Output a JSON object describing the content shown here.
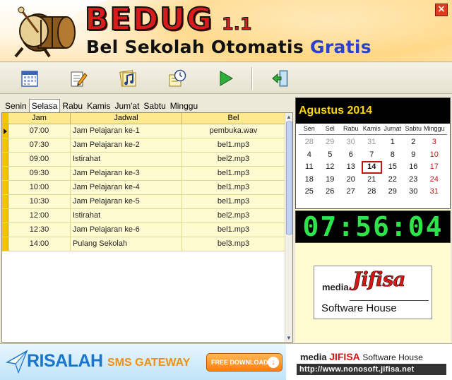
{
  "header": {
    "title": "BEDUG",
    "version": "1.1",
    "subtitle_main": "Bel Sekolah Otomatis",
    "subtitle_accent": "Gratis",
    "close_label": "×"
  },
  "toolbar": {
    "buttons": [
      "calendar-icon",
      "edit-icon",
      "music-icon",
      "clock-icon",
      "play-icon",
      "exit-icon"
    ]
  },
  "tabs": [
    "Senin",
    "Selasa",
    "Rabu",
    "Kamis",
    "Jum'at",
    "Sabtu",
    "Minggu"
  ],
  "active_tab": "Selasa",
  "table": {
    "headers": [
      "Jam",
      "Jadwal",
      "Bel"
    ],
    "rows": [
      {
        "jam": "07:00",
        "jadwal": "Jam Pelajaran ke-1",
        "bel": "pembuka.wav"
      },
      {
        "jam": "07:30",
        "jadwal": "Jam Pelajaran ke-2",
        "bel": "bel1.mp3"
      },
      {
        "jam": "09:00",
        "jadwal": "Istirahat",
        "bel": "bel2.mp3"
      },
      {
        "jam": "09:30",
        "jadwal": "Jam Pelajaran ke-3",
        "bel": "bel1.mp3"
      },
      {
        "jam": "10:00",
        "jadwal": "Jam Pelajaran ke-4",
        "bel": "bel1.mp3"
      },
      {
        "jam": "10:30",
        "jadwal": "Jam Pelajaran ke-5",
        "bel": "bel1.mp3"
      },
      {
        "jam": "12:00",
        "jadwal": "Istirahat",
        "bel": "bel2.mp3"
      },
      {
        "jam": "12:30",
        "jadwal": "Jam Pelajaran ke-6",
        "bel": "bel1.mp3"
      },
      {
        "jam": "14:00",
        "jadwal": "Pulang Sekolah",
        "bel": "bel3.mp3"
      }
    ]
  },
  "calendar": {
    "month_label": "Agustus 2014",
    "days": [
      "Sen",
      "Sel",
      "Rabu",
      "Kamis",
      "Jumat",
      "Sabtu",
      "Minggu"
    ],
    "weeks": [
      [
        "28",
        "29",
        "30",
        "31",
        "1",
        "2",
        "3"
      ],
      [
        "4",
        "5",
        "6",
        "7",
        "8",
        "9",
        "10"
      ],
      [
        "11",
        "12",
        "13",
        "14",
        "15",
        "16",
        "17"
      ],
      [
        "18",
        "19",
        "20",
        "21",
        "22",
        "23",
        "24"
      ],
      [
        "25",
        "26",
        "27",
        "28",
        "29",
        "30",
        "31"
      ]
    ],
    "today": "14"
  },
  "clock": {
    "time": "07:56:04"
  },
  "logo": {
    "media": "media",
    "brand": "Jifisa",
    "tagline": "Software House"
  },
  "banner": {
    "risalah": "RISALAH",
    "sms": "SMS GATEWAY",
    "download_label": "FREE DOWNLOAD",
    "company_media": "media",
    "company_brand": "JIFISA",
    "company_suffix": "Software House",
    "url": "http://www.nonosoft.jifisa.net"
  },
  "colors": {
    "accent_red": "#d81c1c",
    "accent_blue": "#2a43c9",
    "row_yellow": "#fffbd0",
    "clock_green": "#2fe34a",
    "calendar_title": "#ffd800"
  }
}
